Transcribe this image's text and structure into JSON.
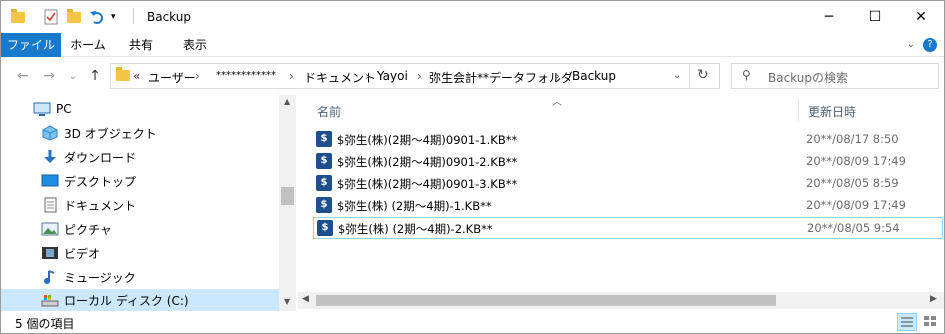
{
  "window": {
    "title": "Backup",
    "minimize_glyph": "─",
    "maximize_glyph": "☐",
    "close_glyph": "✕"
  },
  "ribbon": {
    "tabs": [
      "ファイル",
      "ホーム",
      "共有",
      "表示"
    ]
  },
  "address": {
    "overflow": "«",
    "segments": [
      "ユーザー",
      "************",
      "ドキュメント",
      "Yayoi",
      "弥生会計**データフォルダ",
      "Backup"
    ],
    "separator": "›"
  },
  "search": {
    "placeholder": "Backupの検索"
  },
  "sidebar": {
    "items": [
      {
        "label": "PC",
        "icon": "pc-icon"
      },
      {
        "label": "3D オブジェクト",
        "icon": "3d-objects-icon"
      },
      {
        "label": "ダウンロード",
        "icon": "download-icon"
      },
      {
        "label": "デスクトップ",
        "icon": "desktop-icon"
      },
      {
        "label": "ドキュメント",
        "icon": "document-icon"
      },
      {
        "label": "ピクチャ",
        "icon": "pictures-icon"
      },
      {
        "label": "ビデオ",
        "icon": "video-icon"
      },
      {
        "label": "ミュージック",
        "icon": "music-icon"
      },
      {
        "label": "ローカル ディスク (C:)",
        "icon": "local-disk-icon"
      }
    ]
  },
  "columns": {
    "name": "名前",
    "modified": "更新日時"
  },
  "files": [
    {
      "name": "$弥生(株)(2期～4期)0901-1.KB**",
      "date": "20**/08/17 8:50"
    },
    {
      "name": "$弥生(株)(2期～4期)0901-2.KB**",
      "date": "20**/08/09 17:49"
    },
    {
      "name": "$弥生(株)(2期～4期)0901-3.KB**",
      "date": "20**/08/05 8:59"
    },
    {
      "name": "$弥生(株) (2期～4期)-1.KB**",
      "date": "20**/08/09 17:49"
    },
    {
      "name": "$弥生(株) (2期～4期)-2.KB**",
      "date": "20**/08/05 9:54"
    }
  ],
  "status": {
    "item_count": "5 個の項目"
  },
  "colors": {
    "accent": "#1979ca",
    "selection": "#cce8ff",
    "selection_border": "#99d1ff",
    "file_icon": "#1e4e8c"
  }
}
